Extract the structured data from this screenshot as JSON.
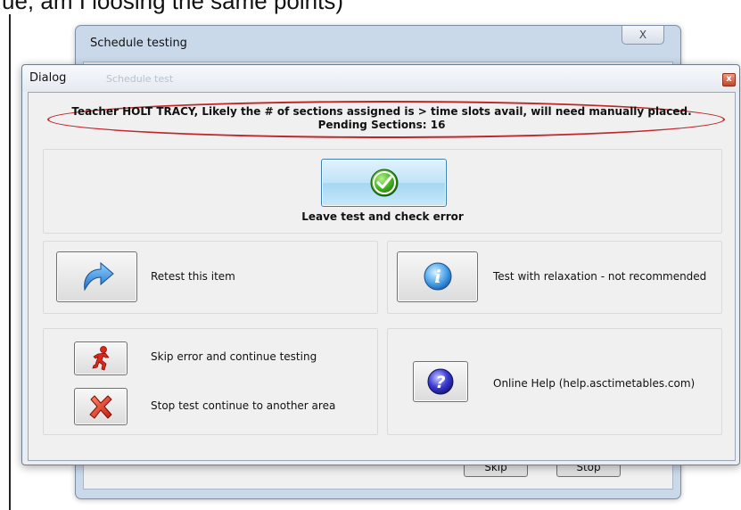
{
  "background": {
    "top_text": "ue, am I loosing the same points)",
    "window_title": "Schedule testing",
    "close_label": "X",
    "ghost_text": "Schedule test",
    "skip_label": "Skip",
    "stop_label": "Stop"
  },
  "dialog": {
    "title": "Dialog",
    "close_label": "x",
    "message_line1": "Teacher HOLT TRACY,  Likely the # of sections assigned is > time slots avail, will need manually placed.",
    "message_line2": "Pending Sections: 16",
    "leave_label": "Leave test and check error",
    "retest_label": "Retest this item",
    "relax_label": "Test with relaxation - not recommended",
    "skip_label": "Skip error and continue testing",
    "stop_label": "Stop test  continue to another area",
    "help_label": "Online Help (help.asctimetables.com)"
  },
  "icons": {
    "check": "check-circle-icon",
    "retest": "curved-arrow-icon",
    "info": "info-icon",
    "skip": "running-man-icon",
    "stop": "red-x-icon",
    "help": "question-icon"
  },
  "colors": {
    "highlight_ellipse": "#c0262a",
    "accent_blue": "#3c7fb1"
  }
}
